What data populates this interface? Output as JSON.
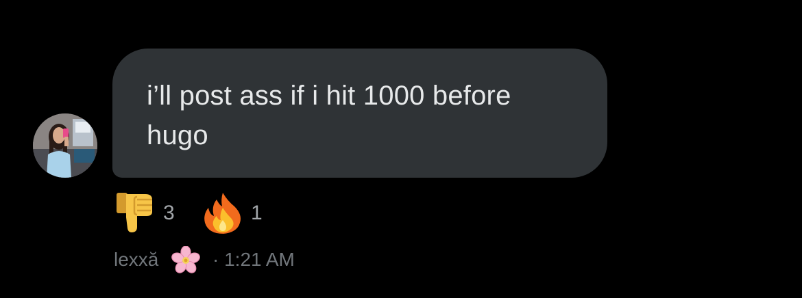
{
  "message": {
    "text": "i’ll post ass if i hit 1000 before hugo",
    "bubble_color": "#2f3336",
    "text_color": "#e7e9ea"
  },
  "reactions": [
    {
      "icon": "thumbs-down-icon",
      "count": "3"
    },
    {
      "icon": "fire-icon",
      "count": "1"
    }
  ],
  "sender": {
    "name": "lexxă",
    "name_emoji_icon": "cherry-blossom-icon",
    "timestamp": "· 1:21 AM"
  },
  "colors": {
    "background": "#000000",
    "meta_text": "#71767b",
    "count_text": "#a2a6aa"
  }
}
